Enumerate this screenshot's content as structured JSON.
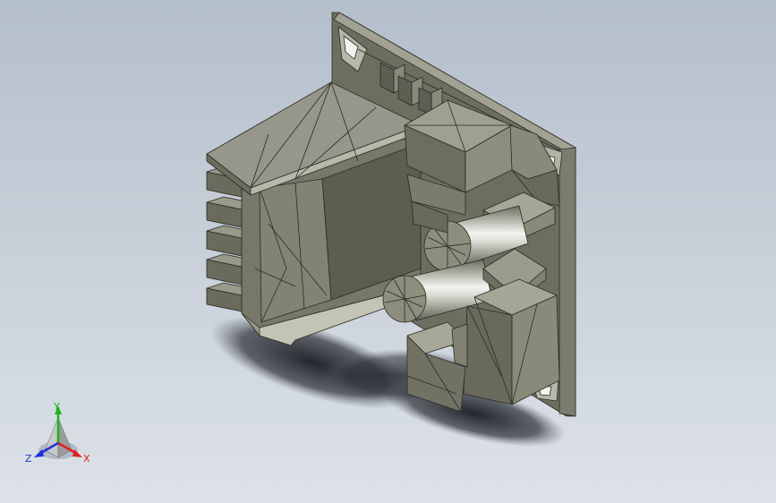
{
  "viewport": {
    "background_top": "#b4bfcc",
    "background_bottom": "#dde2e8",
    "model_color": "#8a8a78",
    "edge_color": "#2a2a22"
  },
  "triad": {
    "x_label": "X",
    "y_label": "Y",
    "z_label": "Z",
    "x_color": "#e02020",
    "y_color": "#18b818",
    "z_color": "#2030e0"
  }
}
